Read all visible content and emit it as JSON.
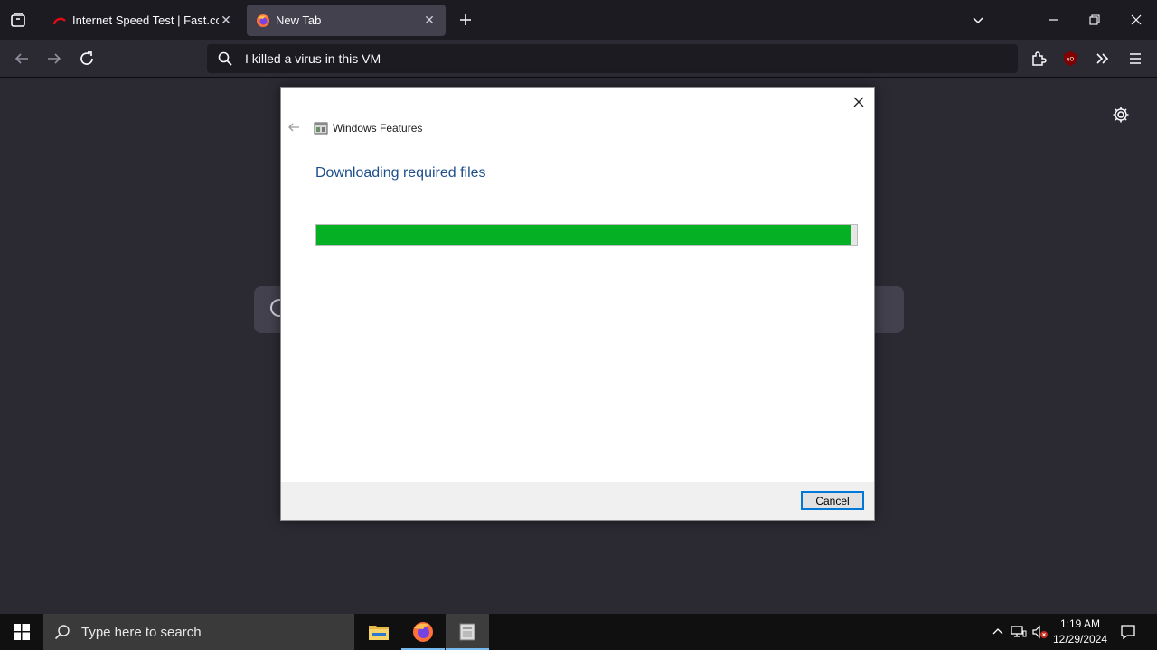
{
  "browser": {
    "tabs": [
      {
        "title": "Internet Speed Test | Fast.com",
        "active": false
      },
      {
        "title": "New Tab",
        "active": true
      }
    ],
    "address_bar": {
      "value": "I killed a virus in this VM"
    }
  },
  "dialog": {
    "title": "Windows Features",
    "heading": "Downloading required files",
    "progress_percent": 99,
    "cancel_label": "Cancel"
  },
  "taskbar": {
    "search_placeholder": "Type here to search",
    "apps": [
      "file-explorer",
      "firefox",
      "windows-features"
    ],
    "time": "1:19 AM",
    "date": "12/29/2024"
  },
  "colors": {
    "progress": "#06b025",
    "heading": "#1e4e8c",
    "focus_border": "#0078d7",
    "tabbar": "#1c1b22",
    "page": "#2b2a33"
  }
}
